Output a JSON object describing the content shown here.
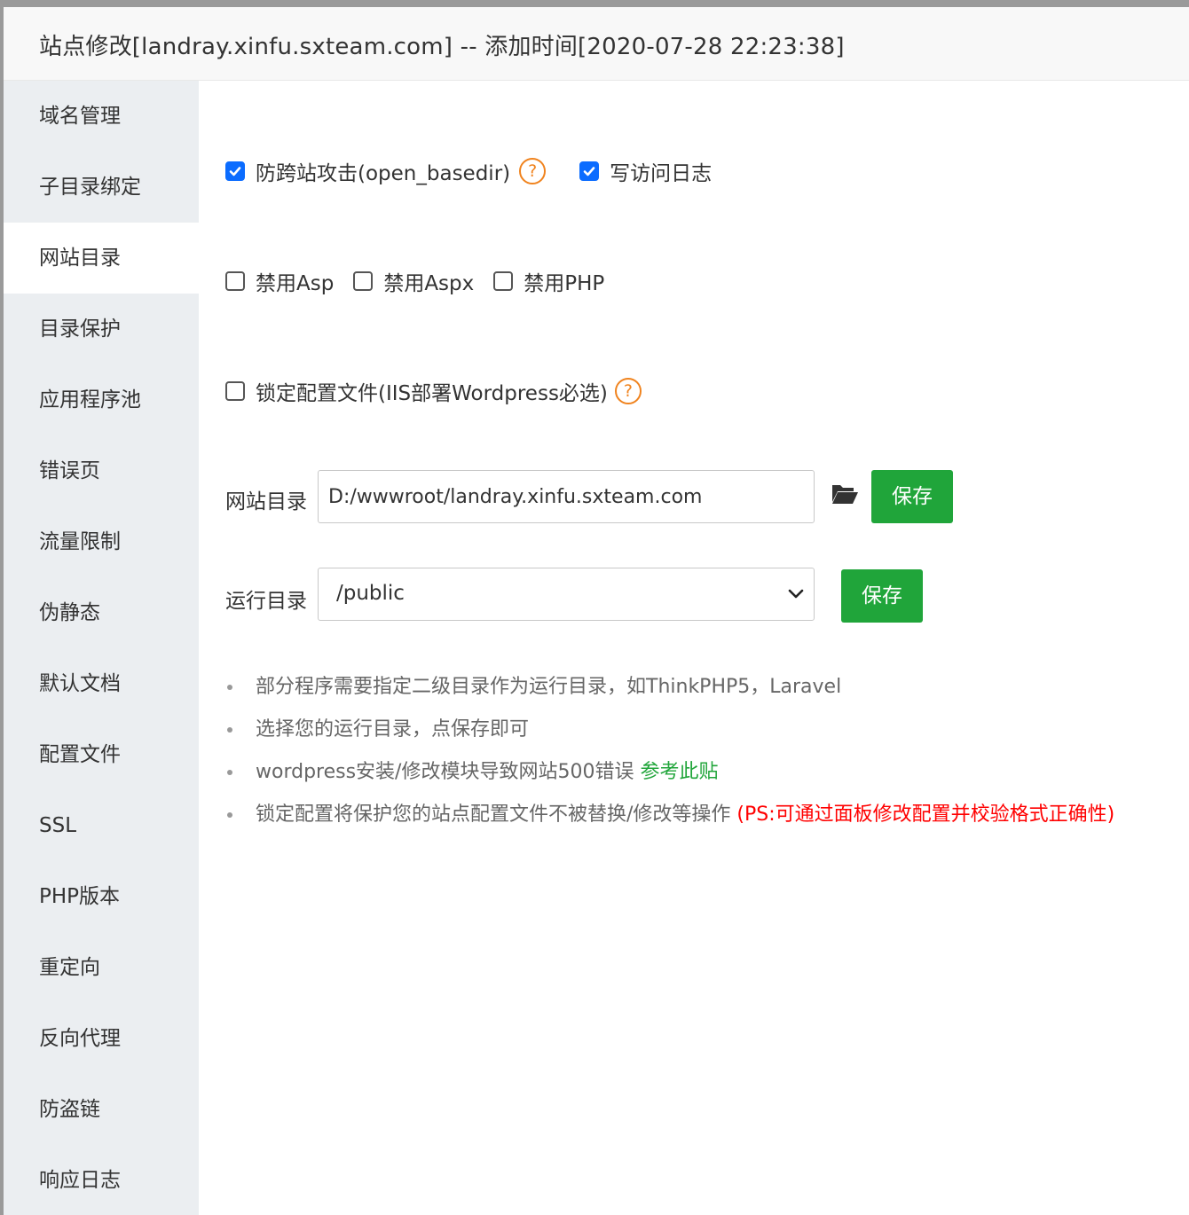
{
  "title": "站点修改[landray.xinfu.sxteam.com] -- 添加时间[2020-07-28 22:23:38]",
  "sidebar": {
    "active_index": 2,
    "items": [
      {
        "label": "域名管理"
      },
      {
        "label": "子目录绑定"
      },
      {
        "label": "网站目录"
      },
      {
        "label": "目录保护"
      },
      {
        "label": "应用程序池"
      },
      {
        "label": "错误页"
      },
      {
        "label": "流量限制"
      },
      {
        "label": "伪静态"
      },
      {
        "label": "默认文档"
      },
      {
        "label": "配置文件"
      },
      {
        "label": "SSL"
      },
      {
        "label": "PHP版本"
      },
      {
        "label": "重定向"
      },
      {
        "label": "反向代理"
      },
      {
        "label": "防盗链"
      },
      {
        "label": "响应日志"
      }
    ]
  },
  "options": {
    "anti_xss": {
      "label": "防跨站攻击(open_basedir)",
      "checked": true,
      "help": "?"
    },
    "access_log": {
      "label": "写访问日志",
      "checked": true
    },
    "disable_asp": {
      "label": "禁用Asp",
      "checked": false
    },
    "disable_aspx": {
      "label": "禁用Aspx",
      "checked": false
    },
    "disable_php": {
      "label": "禁用PHP",
      "checked": false
    },
    "lock_config": {
      "label": "锁定配置文件(IIS部署Wordpress必选)",
      "checked": false,
      "help": "?"
    }
  },
  "site_dir": {
    "label": "网站目录",
    "value": "D:/wwwroot/landray.xinfu.sxteam.com",
    "folder_icon": "folder-open-icon",
    "save_label": "保存"
  },
  "run_dir": {
    "label": "运行目录",
    "selected": "/public",
    "save_label": "保存"
  },
  "tips": {
    "t1": "部分程序需要指定二级目录作为运行目录，如ThinkPHP5，Laravel",
    "t2": "选择您的运行目录，点保存即可",
    "t3": "wordpress安装/修改模块导致网站500错误 ",
    "t3_link": "参考此贴",
    "t4": "锁定配置将保护您的站点配置文件不被替换/修改等操作 ",
    "t4_warning": "(PS:可通过面板修改配置并校验格式正确性)"
  },
  "colors": {
    "accent_green": "#20a53a",
    "checkbox_blue": "#0b6cff",
    "help_orange": "#f0831e",
    "warning_red": "#ff0000",
    "sidebar_bg": "#ebeef1"
  }
}
